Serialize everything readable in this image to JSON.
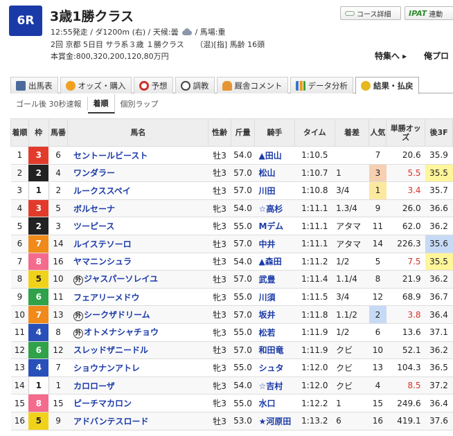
{
  "header": {
    "race_number": "6R",
    "race_name": "3歳1勝クラス",
    "info_line1_prefix": "12:55発走 / ダ1200m (右) / 天候:曇",
    "info_line1_suffix": "/ 馬場:重",
    "info_line2": "2回 京都 5日目 サラ系３歳 １勝クラス　　（混)[指] 馬齢 16頭",
    "info_line3": "本賞金:800,320,200,120,80万円",
    "course_button": "コース詳細",
    "ipat_logo": "IPAT",
    "ipat_text": "連動",
    "feature_link": "特集へ ▸",
    "feature_link2": "俺プロ"
  },
  "tabs": [
    "出馬表",
    "オッズ・購入",
    "予想",
    "調教",
    "厩舎コメント",
    "データ分析",
    "結果・払戻"
  ],
  "subtabs": [
    "ゴール後 30秒速報",
    "着順",
    "個別ラップ"
  ],
  "table": {
    "headers": [
      "着順",
      "枠",
      "馬番",
      "馬名",
      "性齢",
      "斤量",
      "騎手",
      "タイム",
      "着差",
      "人気",
      "単勝オッズ",
      "後3F"
    ],
    "rows": [
      {
        "rank": "1",
        "frame": "3",
        "num": "6",
        "name": "セントールビースト",
        "gai": false,
        "sex": "牡3",
        "weight": "54.0",
        "jockey": "▲田山",
        "time": "1:10.5",
        "margin": "",
        "pop": "7",
        "odds": "20.6",
        "last3f": "35.9"
      },
      {
        "rank": "2",
        "frame": "2",
        "num": "4",
        "name": "ワンダラー",
        "gai": false,
        "sex": "牡3",
        "weight": "57.0",
        "jockey": "松山",
        "time": "1:10.7",
        "margin": "1",
        "pop": "3",
        "odds": "5.5",
        "last3f": "35.5"
      },
      {
        "rank": "3",
        "frame": "1",
        "num": "2",
        "name": "ルークススペイ",
        "gai": false,
        "sex": "牡3",
        "weight": "57.0",
        "jockey": "川田",
        "time": "1:10.8",
        "margin": "3/4",
        "pop": "1",
        "odds": "3.4",
        "last3f": "35.7"
      },
      {
        "rank": "4",
        "frame": "3",
        "num": "5",
        "name": "ボルセーナ",
        "gai": false,
        "sex": "牝3",
        "weight": "54.0",
        "jockey": "☆高杉",
        "time": "1:11.1",
        "margin": "1.3/4",
        "pop": "9",
        "odds": "26.0",
        "last3f": "36.6"
      },
      {
        "rank": "5",
        "frame": "2",
        "num": "3",
        "name": "ツーピース",
        "gai": false,
        "sex": "牝3",
        "weight": "55.0",
        "jockey": "Mデム",
        "time": "1:11.1",
        "margin": "アタマ",
        "pop": "11",
        "odds": "62.0",
        "last3f": "36.2"
      },
      {
        "rank": "6",
        "frame": "7",
        "num": "14",
        "name": "ルイステソーロ",
        "gai": false,
        "sex": "牡3",
        "weight": "57.0",
        "jockey": "中井",
        "time": "1:11.1",
        "margin": "アタマ",
        "pop": "14",
        "odds": "226.3",
        "last3f": "35.6"
      },
      {
        "rank": "7",
        "frame": "8",
        "num": "16",
        "name": "ヤマニンシュラ",
        "gai": false,
        "sex": "牡3",
        "weight": "54.0",
        "jockey": "▲森田",
        "time": "1:11.2",
        "margin": "1/2",
        "pop": "5",
        "odds": "7.5",
        "last3f": "35.5"
      },
      {
        "rank": "8",
        "frame": "5",
        "num": "10",
        "name": "ジャスパーソレイユ",
        "gai": true,
        "sex": "牡3",
        "weight": "57.0",
        "jockey": "武豊",
        "time": "1:11.4",
        "margin": "1.1/4",
        "pop": "8",
        "odds": "21.9",
        "last3f": "36.2"
      },
      {
        "rank": "9",
        "frame": "6",
        "num": "11",
        "name": "フェアリーメドウ",
        "gai": false,
        "sex": "牝3",
        "weight": "55.0",
        "jockey": "川須",
        "time": "1:11.5",
        "margin": "3/4",
        "pop": "12",
        "odds": "68.9",
        "last3f": "36.7"
      },
      {
        "rank": "10",
        "frame": "7",
        "num": "13",
        "name": "シークザドリーム",
        "gai": true,
        "sex": "牡3",
        "weight": "57.0",
        "jockey": "坂井",
        "time": "1:11.8",
        "margin": "1.1/2",
        "pop": "2",
        "odds": "3.8",
        "last3f": "36.4"
      },
      {
        "rank": "11",
        "frame": "4",
        "num": "8",
        "name": "オトメナシャチョウ",
        "gai": true,
        "sex": "牝3",
        "weight": "55.0",
        "jockey": "松若",
        "time": "1:11.9",
        "margin": "1/2",
        "pop": "6",
        "odds": "13.6",
        "last3f": "37.1"
      },
      {
        "rank": "12",
        "frame": "6",
        "num": "12",
        "name": "スレッドザニードル",
        "gai": false,
        "sex": "牡3",
        "weight": "57.0",
        "jockey": "和田竜",
        "time": "1:11.9",
        "margin": "クビ",
        "pop": "10",
        "odds": "52.1",
        "last3f": "36.2"
      },
      {
        "rank": "13",
        "frame": "4",
        "num": "7",
        "name": "ショウナンアトレ",
        "gai": false,
        "sex": "牝3",
        "weight": "55.0",
        "jockey": "シュタ",
        "time": "1:12.0",
        "margin": "クビ",
        "pop": "13",
        "odds": "104.3",
        "last3f": "36.5"
      },
      {
        "rank": "14",
        "frame": "1",
        "num": "1",
        "name": "カロローザ",
        "gai": false,
        "sex": "牝3",
        "weight": "54.0",
        "jockey": "☆吉村",
        "time": "1:12.0",
        "margin": "クビ",
        "pop": "4",
        "odds": "8.5",
        "last3f": "37.2"
      },
      {
        "rank": "15",
        "frame": "8",
        "num": "15",
        "name": "ピーチマカロン",
        "gai": false,
        "sex": "牝3",
        "weight": "55.0",
        "jockey": "水口",
        "time": "1:12.2",
        "margin": "1",
        "pop": "15",
        "odds": "249.6",
        "last3f": "36.4"
      },
      {
        "rank": "16",
        "frame": "5",
        "num": "9",
        "name": "アドバンテスロード",
        "gai": false,
        "sex": "牡3",
        "weight": "53.0",
        "jockey": "★河原田",
        "time": "1:13.2",
        "margin": "6",
        "pop": "16",
        "odds": "419.1",
        "last3f": "37.6"
      }
    ]
  }
}
